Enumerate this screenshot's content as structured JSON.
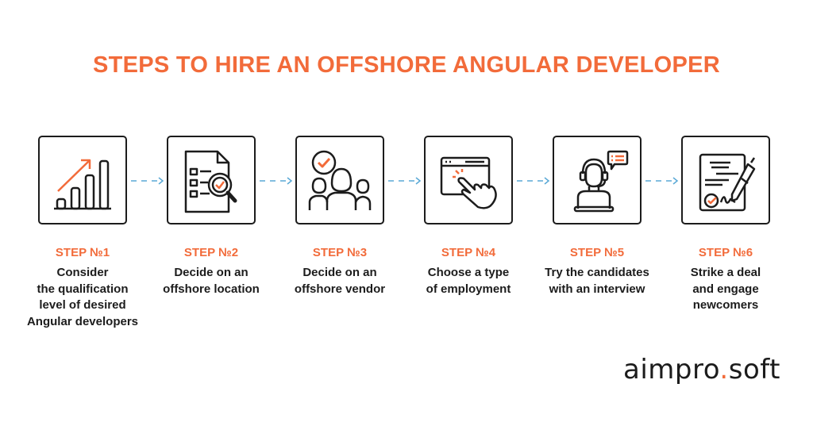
{
  "title": "STEPS TO HIRE AN OFFSHORE ANGULAR DEVELOPER",
  "colors": {
    "accent": "#f26b3a",
    "ink": "#1c1c1c",
    "connector": "#5aa9d6"
  },
  "steps": [
    {
      "label": "STEP №1",
      "text": "Consider\nthe qualification\nlevel of desired\nAngular developers",
      "icon": "growth-chart-icon"
    },
    {
      "label": "STEP №2",
      "text": "Decide on an\noffshore location",
      "icon": "document-search-icon"
    },
    {
      "label": "STEP №3",
      "text": "Decide on an\noffshore vendor",
      "icon": "team-approve-icon"
    },
    {
      "label": "STEP №4",
      "text": "Choose a type\nof employment",
      "icon": "click-window-icon"
    },
    {
      "label": "STEP №5",
      "text": "Try the candidates\nwith an interview",
      "icon": "interview-headset-icon"
    },
    {
      "label": "STEP №6",
      "text": "Strike a deal\nand engage\nnewcomers",
      "icon": "contract-sign-icon"
    }
  ],
  "logo": {
    "part1": "aimpro",
    "dot": ".",
    "part2": "soft"
  }
}
